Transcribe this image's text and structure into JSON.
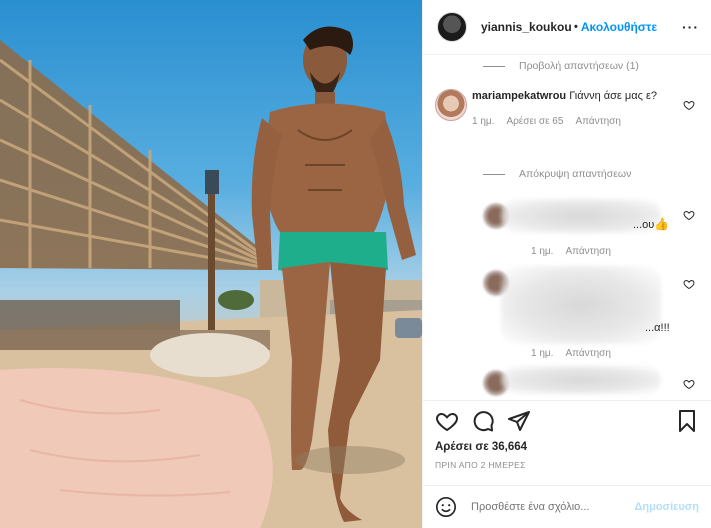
{
  "header": {
    "username": "yiannis_koukour...",
    "separator": "•",
    "follow_label": "Ακολουθήστε",
    "more_label": "···"
  },
  "comments": {
    "view_replies": "Προβολή απαντήσεων (1)",
    "main_comment": {
      "username": "mariampekatwrou",
      "text": "Γιάννη άσε μας ε?",
      "time": "1 ημ.",
      "likes": "Αρέσει σε 65",
      "reply_label": "Απάντηση"
    },
    "hide_replies": "Απόκρυψη απαντήσεων",
    "replies": [
      {
        "tail": "...ου",
        "emoji": "👍",
        "time": "1 ημ.",
        "reply_label": "Απάντηση"
      },
      {
        "tail": "...α!!!",
        "time": "1 ημ.",
        "reply_label": "Απάντηση"
      }
    ]
  },
  "actions": {
    "likes": "Αρέσει σε 36,664",
    "date": "ΠΡΙΝ ΑΠΟ 2 ΗΜΕΡΕΣ"
  },
  "add_comment": {
    "placeholder": "Προσθέστε ένα σχόλιο...",
    "post_label": "Δημοσίευση"
  },
  "icons": [
    "heart-icon",
    "comment-icon",
    "share-icon",
    "bookmark-icon",
    "emoji-icon",
    "more-icon"
  ],
  "colors": {
    "accent": "#0095f6",
    "post_disabled": "#b2dffc",
    "meta": "#8e8e8e"
  }
}
